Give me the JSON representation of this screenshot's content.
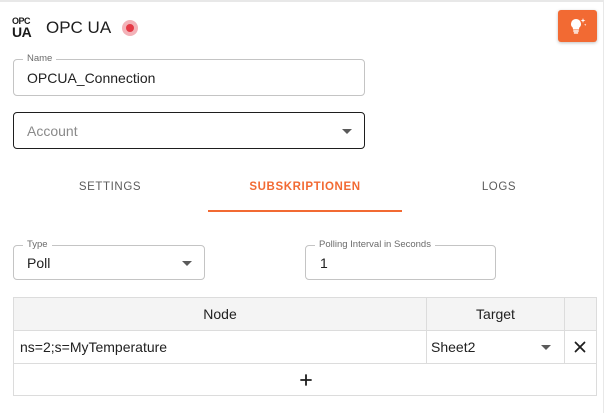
{
  "header": {
    "logo_top": "OPC",
    "logo_bottom": "UA",
    "title": "OPC UA",
    "status_icon": "status-dot-icon",
    "idea_icon": "lightbulb-sparkle-icon",
    "accent_color": "#f26a33",
    "status_color": "#e53945"
  },
  "form": {
    "name_label": "Name",
    "name_value": "OPCUA_Connection",
    "account_placeholder": "Account"
  },
  "tabs": [
    {
      "label": "SETTINGS",
      "active": false
    },
    {
      "label": "SUBSKRIPTIONEN",
      "active": true
    },
    {
      "label": "LOGS",
      "active": false
    }
  ],
  "subscription": {
    "type_label": "Type",
    "type_value": "Poll",
    "interval_label": "Polling Interval in Seconds",
    "interval_value": "1"
  },
  "table": {
    "columns": [
      "Node",
      "Target"
    ],
    "rows": [
      {
        "node": "ns=2;s=MyTemperature",
        "target": "Sheet2"
      }
    ],
    "remove_icon": "close-icon",
    "add_label": "+"
  }
}
